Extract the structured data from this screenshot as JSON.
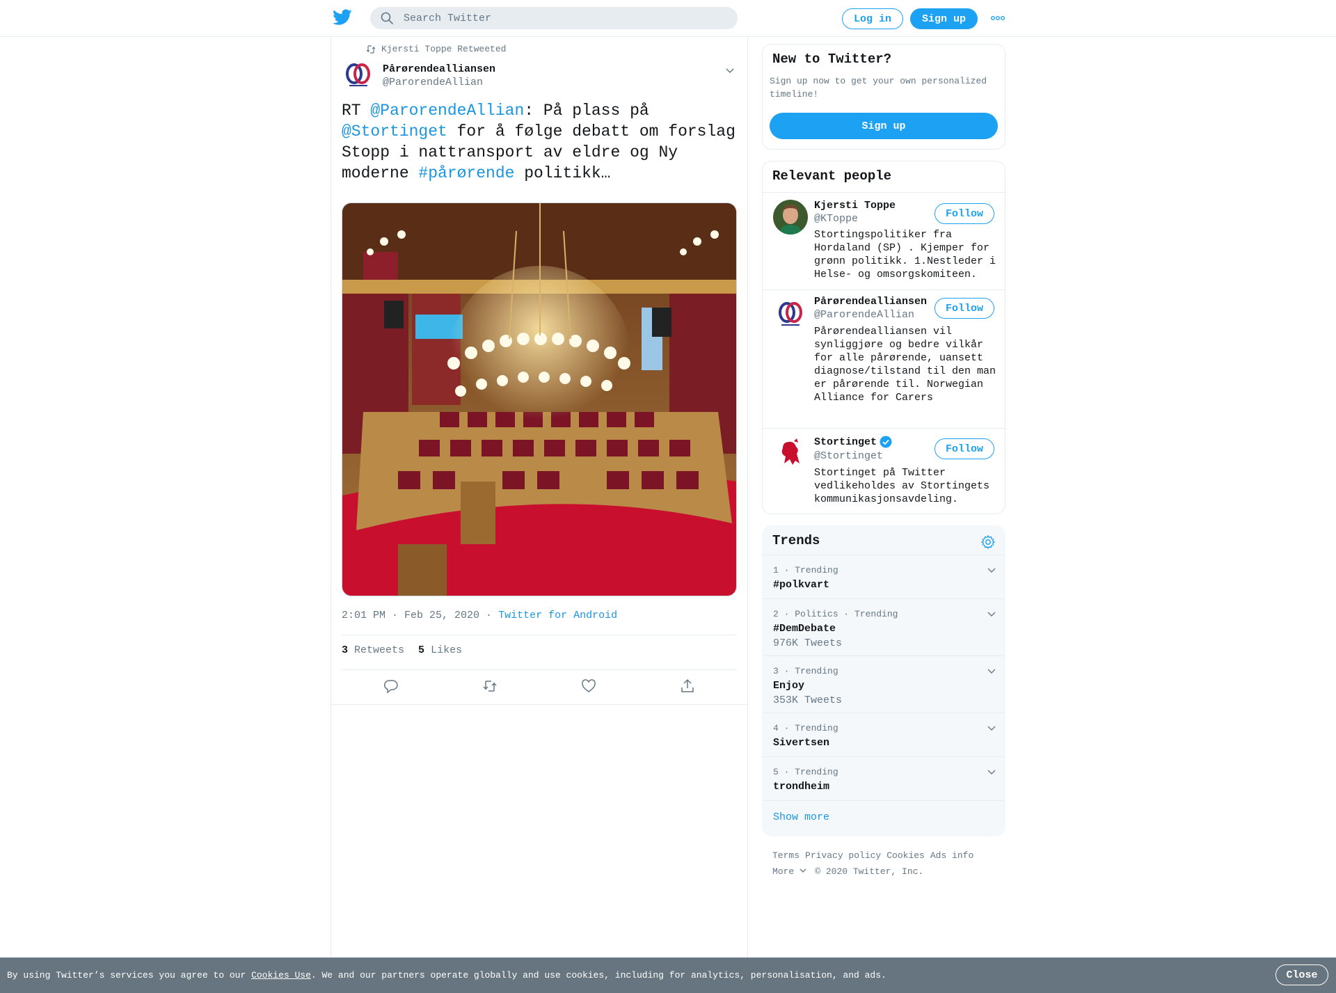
{
  "header": {
    "logo_icon": "twitter-bird-icon",
    "search_placeholder": "Search Twitter",
    "login_label": "Log in",
    "signup_label": "Sign up",
    "more_icon": "more-dots-icon",
    "brand_color": "#1da1f2"
  },
  "tweet": {
    "retweet_context": "Kjersti Toppe Retweeted",
    "author_name": "Pårørendealliansen",
    "author_handle": "@ParorendeAllian",
    "text_parts": {
      "p1": "RT ",
      "p2": "@ParorendeAllian",
      "p3": ": På plass på ",
      "p4": "@Stortinget",
      "p5": " for å følge debatt om forslag Stopp i nattransport av eldre og Ny moderne ",
      "p6": "#pårørende",
      "p7": " politikk…"
    },
    "timestamp": "2:01 PM · Feb 25, 2020",
    "dot": " · ",
    "source": "Twitter for Android",
    "retweets_count": "3",
    "retweets_label": "Retweets",
    "likes_count": "5",
    "likes_label": "Likes",
    "actions": [
      "reply-icon",
      "retweet-icon",
      "like-icon",
      "share-icon"
    ]
  },
  "sidebar": {
    "new_to_twitter": {
      "title": "New to Twitter?",
      "subtitle": "Sign up now to get your own personalized timeline!",
      "button": "Sign up"
    },
    "relevant_people": {
      "title": "Relevant people",
      "follow_label": "Follow",
      "people": [
        {
          "name": "Kjersti Toppe",
          "handle": "@KToppe",
          "bio": "Stortingspolitiker fra Hordaland (SP) . Kjemper for grønn politikk. 1.Nestleder i Helse- og omsorgskomiteen."
        },
        {
          "name": "Pårørendealliansen",
          "handle": "@ParorendeAllian",
          "bio": "Pårørendealliansen vil synliggjøre og bedre vilkår for alle pårørende, uansett diagnose/tilstand til den man er pårørende til. Norwegian Alliance for Carers"
        },
        {
          "name": "Stortinget",
          "handle": "@Stortinget",
          "verified": true,
          "bio": "Stortinget på Twitter vedlikeholdes av Stortingets kommunikasjonsavdeling."
        }
      ]
    },
    "trends": {
      "title": "Trends",
      "settings_icon": "gear-icon",
      "items": [
        {
          "meta": "1 · Trending",
          "name": "#polkvart",
          "count": ""
        },
        {
          "meta": "2 · Politics · Trending",
          "name": "#DemDebate",
          "count": "976K Tweets"
        },
        {
          "meta": "3 · Trending",
          "name": "Enjoy",
          "count": "353K Tweets"
        },
        {
          "meta": "4 · Trending",
          "name": "Sivertsen",
          "count": ""
        },
        {
          "meta": "5 · Trending",
          "name": "trondheim",
          "count": ""
        }
      ],
      "show_more": "Show more"
    },
    "footer": {
      "links": [
        "Terms",
        "Privacy policy",
        "Cookies",
        "Ads info"
      ],
      "more": "More",
      "copyright": "© 2020 Twitter, Inc."
    }
  },
  "cookie_bar": {
    "text_before": "By using Twitter’s services you agree to our ",
    "link": "Cookies Use",
    "text_after": ". We and our partners operate globally and use cookies, including for analytics, personalisation, and ads.",
    "close": "Close"
  }
}
